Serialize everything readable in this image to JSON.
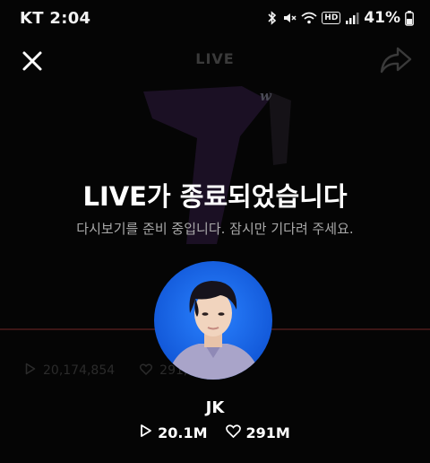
{
  "status_bar": {
    "time": "KT 2:04",
    "hd_badge": "HD",
    "battery": "41%",
    "icons": [
      "bluetooth-icon",
      "mute-icon",
      "wifi-icon",
      "hd-call-icon",
      "signal-icon",
      "battery-icon"
    ]
  },
  "header": {
    "title": "LIVE",
    "close_icon": "close-icon",
    "share_icon": "share-icon"
  },
  "background": {
    "logo": "w",
    "views": "20,174,854",
    "likes": "291,11"
  },
  "message": {
    "title": "LIVE가 종료되었습니다",
    "subtitle": "다시보기를 준비 중입니다. 잠시만 기다려 주세요."
  },
  "artist": {
    "name": "JK",
    "plays": "20.1M",
    "likes": "291M"
  },
  "colors": {
    "background": "#050505",
    "avatar_bg": "#1e6ae0",
    "progress_line": "#3c1616"
  }
}
